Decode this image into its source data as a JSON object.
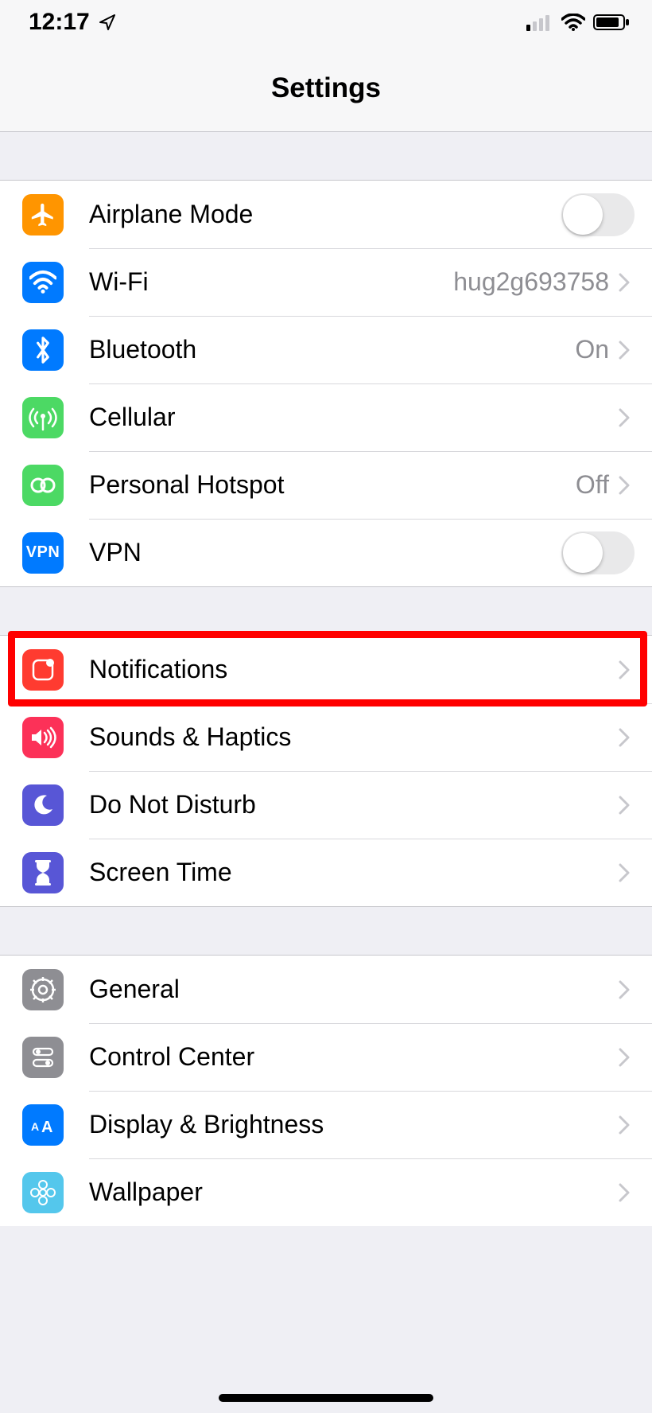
{
  "statusbar": {
    "time": "12:17"
  },
  "header": {
    "title": "Settings"
  },
  "rows": {
    "airplane": {
      "label": "Airplane Mode"
    },
    "wifi": {
      "label": "Wi-Fi",
      "detail": "hug2g693758"
    },
    "bluetooth": {
      "label": "Bluetooth",
      "detail": "On"
    },
    "cellular": {
      "label": "Cellular"
    },
    "hotspot": {
      "label": "Personal Hotspot",
      "detail": "Off"
    },
    "vpn": {
      "label": "VPN",
      "iconText": "VPN"
    },
    "notifications": {
      "label": "Notifications"
    },
    "sounds": {
      "label": "Sounds & Haptics"
    },
    "dnd": {
      "label": "Do Not Disturb"
    },
    "screentime": {
      "label": "Screen Time"
    },
    "general": {
      "label": "General"
    },
    "controlcenter": {
      "label": "Control Center"
    },
    "display": {
      "label": "Display & Brightness"
    },
    "wallpaper": {
      "label": "Wallpaper"
    }
  }
}
